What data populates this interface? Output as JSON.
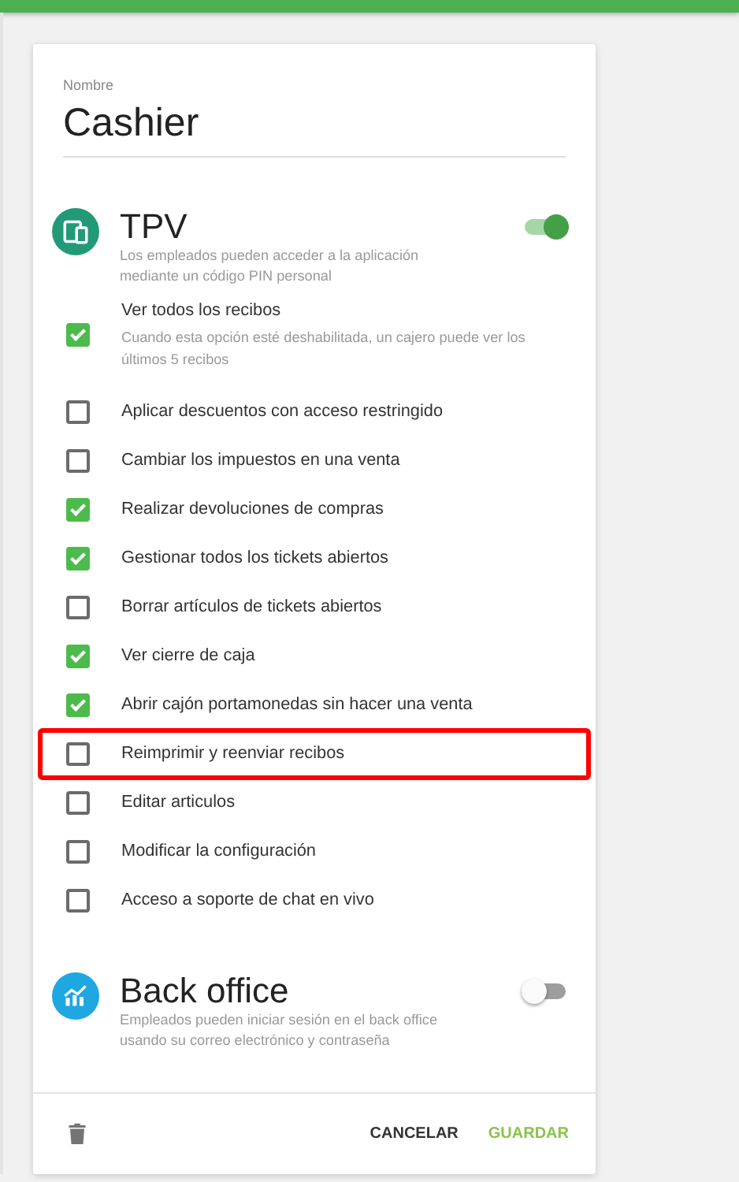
{
  "name_field": {
    "label": "Nombre",
    "value": "Cashier"
  },
  "sections": [
    {
      "kind": "pos",
      "title": "TPV",
      "description": "Los empleados pueden acceder a la aplicación mediante un código PIN personal",
      "on": true,
      "permissions": [
        {
          "label": "Ver todos los recibos",
          "hint": "Cuando esta opción esté deshabilitada, un cajero puede ver los últimos 5 recibos",
          "checked": true,
          "highlighted": false
        },
        {
          "label": "Aplicar descuentos con acceso restringido",
          "checked": false,
          "highlighted": false
        },
        {
          "label": "Cambiar los impuestos en una venta",
          "checked": false,
          "highlighted": false
        },
        {
          "label": "Realizar devoluciones de compras",
          "checked": true,
          "highlighted": false
        },
        {
          "label": "Gestionar todos los tickets abiertos",
          "checked": true,
          "highlighted": false
        },
        {
          "label": "Borrar artículos de tickets abiertos",
          "checked": false,
          "highlighted": false
        },
        {
          "label": "Ver cierre de caja",
          "checked": true,
          "highlighted": false
        },
        {
          "label": "Abrir cajón portamonedas sin hacer una venta",
          "checked": true,
          "highlighted": false
        },
        {
          "label": "Reimprimir y reenviar recibos",
          "checked": false,
          "highlighted": true
        },
        {
          "label": "Editar articulos",
          "checked": false,
          "highlighted": false
        },
        {
          "label": "Modificar la configuración",
          "checked": false,
          "highlighted": false
        },
        {
          "label": "Acceso a soporte de chat en vivo",
          "checked": false,
          "highlighted": false
        }
      ]
    },
    {
      "kind": "back_office",
      "title": "Back office",
      "description": "Empleados pueden iniciar sesión en el back office usando su correo electrónico y contraseña",
      "on": false
    }
  ],
  "footer": {
    "buttons": [
      {
        "label": "CANCELAR",
        "kind": "cancel"
      },
      {
        "label": "GUARDAR",
        "kind": "save"
      }
    ]
  }
}
